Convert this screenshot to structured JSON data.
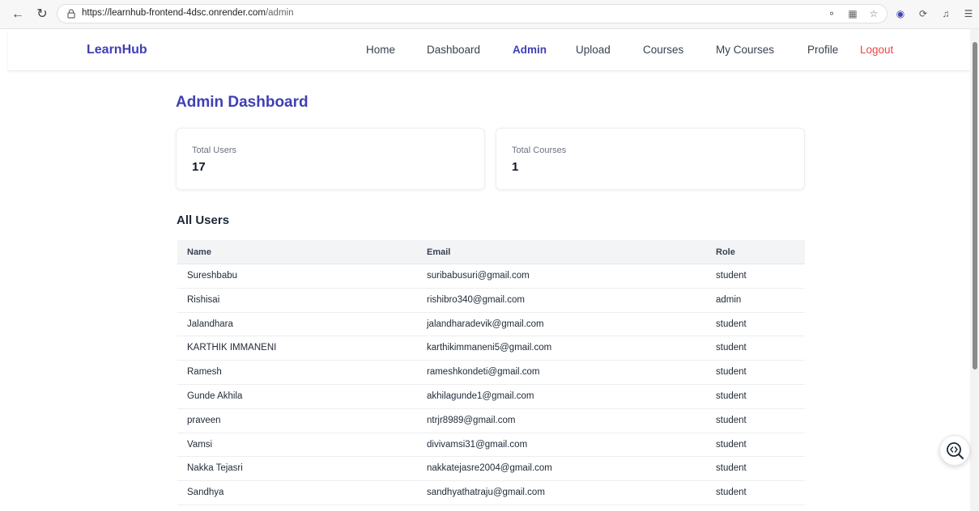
{
  "browser": {
    "url_main": "https://learnhub-frontend-4dsc.onrender.com",
    "url_path": "/admin"
  },
  "app": {
    "logo": "LearnHub",
    "nav": [
      {
        "label": "Home"
      },
      {
        "label": "Dashboard"
      },
      {
        "label": "Admin"
      },
      {
        "label": "Upload"
      },
      {
        "label": "Courses"
      },
      {
        "label": "My Courses"
      },
      {
        "label": "Profile"
      },
      {
        "label": "Logout"
      }
    ],
    "accent": "#3f3fb5",
    "logout_color": "#ef4444"
  },
  "dashboard": {
    "title": "Admin Dashboard",
    "stats": [
      {
        "label": "Total Users",
        "value": "17"
      },
      {
        "label": "Total Courses",
        "value": "1"
      }
    ]
  },
  "users": {
    "title": "All Users",
    "columns": [
      "Name",
      "Email",
      "Role"
    ],
    "rows": [
      [
        "Sureshbabu",
        "suribabusuri@gmail.com",
        "student"
      ],
      [
        "Rishisai",
        "rishibro340@gmail.com",
        "admin"
      ],
      [
        "Jalandhara",
        "jalandharadevik@gmail.com",
        "student"
      ],
      [
        "KARTHIK IMMANENI",
        "karthikimmaneni5@gmail.com",
        "student"
      ],
      [
        "Ramesh",
        "rameshkondeti@gmail.com",
        "student"
      ],
      [
        "Gunde Akhila",
        "akhilagunde1@gmail.com",
        "student"
      ],
      [
        "praveen",
        "ntrjr8989@gmail.com",
        "student"
      ],
      [
        "Vamsi",
        "divivamsi31@gmail.com",
        "student"
      ],
      [
        "Nakka Tejasri",
        "nakkatejasre2004@gmail.com",
        "student"
      ],
      [
        "Sandhya",
        "sandhyathatraju@gmail.com",
        "student"
      ]
    ]
  },
  "icons": {
    "back": "back-arrow-icon",
    "reload": "reload-icon",
    "lock": "lock-icon",
    "fab": "zoom-code-icon"
  }
}
